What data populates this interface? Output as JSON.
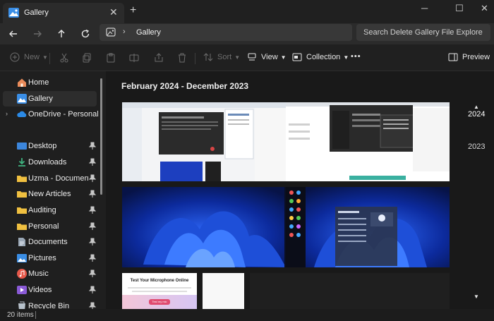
{
  "window": {
    "tab_title": "Gallery",
    "tab_close": "✕",
    "new_tab": "+",
    "controls": [
      "─",
      "☐",
      "✕"
    ]
  },
  "nav": {
    "breadcrumb_sep": "›",
    "location": "Gallery",
    "search_placeholder": "Search Delete Gallery File Explore"
  },
  "toolbar": {
    "new_label": "New",
    "sort_label": "Sort",
    "view_label": "View",
    "collection_label": "Collection",
    "more_label": "•••",
    "preview_label": "Preview"
  },
  "sidebar": {
    "items": [
      {
        "label": "Home",
        "icon": "home-icon"
      },
      {
        "label": "Gallery",
        "icon": "gallery-icon"
      },
      {
        "label": "OneDrive - Personal",
        "icon": "cloud-icon"
      },
      {
        "label": "Desktop",
        "icon": "desktop-icon"
      },
      {
        "label": "Downloads",
        "icon": "download-icon"
      },
      {
        "label": "Uzma - Documents Rec",
        "icon": "folder-icon"
      },
      {
        "label": "New Articles",
        "icon": "folder-icon"
      },
      {
        "label": "Auditing",
        "icon": "folder-icon"
      },
      {
        "label": "Personal",
        "icon": "folder-icon"
      },
      {
        "label": "Documents",
        "icon": "documents-icon"
      },
      {
        "label": "Pictures",
        "icon": "pictures-icon"
      },
      {
        "label": "Music",
        "icon": "music-icon"
      },
      {
        "label": "Videos",
        "icon": "videos-icon"
      },
      {
        "label": "Recycle Bin",
        "icon": "recycle-bin-icon"
      }
    ]
  },
  "gallery": {
    "date_range": "February 2024 - December 2023",
    "years": [
      "2024",
      "2023"
    ],
    "mic_thumb_title": "Test Your Microphone Online",
    "mic_thumb_button": "Test my mic"
  },
  "status": {
    "item_count": "20 items"
  },
  "colors": {
    "accent": "#4cc2ff",
    "folder": "#f0c040",
    "wallpaper": "#1e4fd8"
  }
}
